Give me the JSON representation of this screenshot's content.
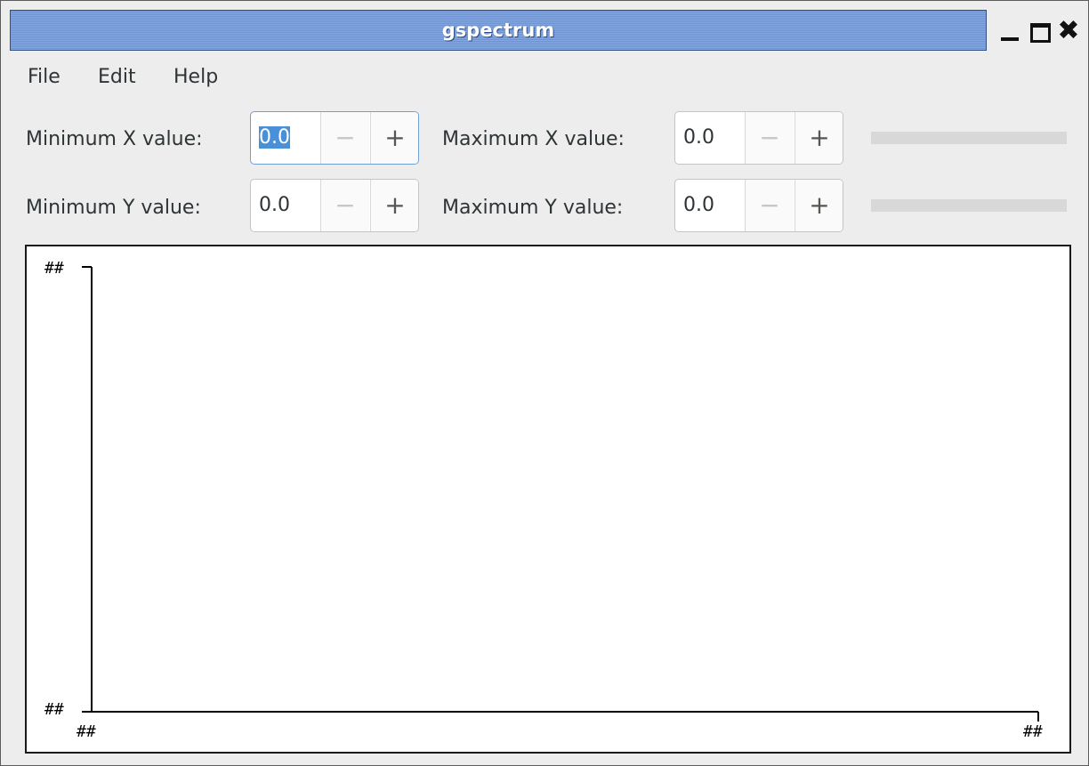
{
  "window": {
    "title": "gspectrum",
    "controls": {
      "minimize_icon": "minimize-icon",
      "maximize_icon": "maximize-icon",
      "close_icon": "close-icon",
      "close_glyph": "✖"
    }
  },
  "menu": {
    "items": [
      "File",
      "Edit",
      "Help"
    ]
  },
  "controls": {
    "min_x": {
      "label": "Minimum X value:",
      "value": "0.0",
      "minus": "−",
      "plus": "+"
    },
    "max_x": {
      "label": "Maximum X value:",
      "value": "0.0",
      "minus": "−",
      "plus": "+"
    },
    "min_y": {
      "label": "Minimum Y value:",
      "value": "0.0",
      "minus": "−",
      "plus": "+"
    },
    "max_y": {
      "label": "Maximum Y value:",
      "value": "0.0",
      "minus": "−",
      "plus": "+"
    }
  },
  "plot": {
    "y_max_label": "##",
    "y_min_label": "##",
    "x_min_label": "##",
    "x_max_label": "##"
  },
  "colors": {
    "title_bar": "#7b9cd6",
    "selection": "#4a90d9",
    "focus_border": "#6f9fd8",
    "slider_track": "#d8d8d8"
  }
}
